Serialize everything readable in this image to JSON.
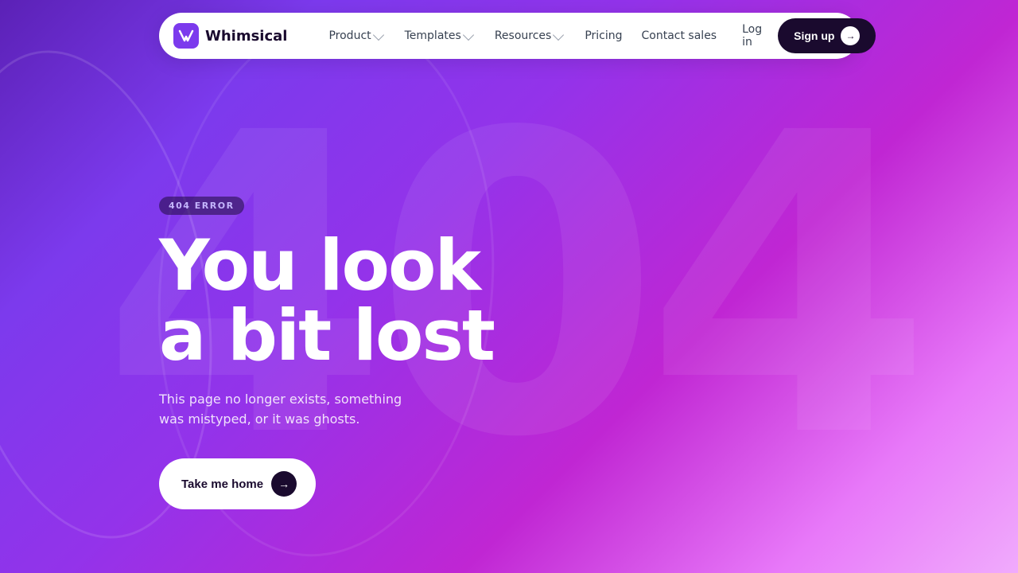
{
  "background": {
    "bg404text": "404"
  },
  "navbar": {
    "logo_text": "Whimsical",
    "links": [
      {
        "label": "Product",
        "has_chevron": true
      },
      {
        "label": "Templates",
        "has_chevron": true
      },
      {
        "label": "Resources",
        "has_chevron": true
      },
      {
        "label": "Pricing",
        "has_chevron": false
      }
    ],
    "contact_label": "Contact sales",
    "login_label": "Log in",
    "signup_label": "Sign up"
  },
  "hero": {
    "badge_text": "404 ERROR",
    "headline_line1": "You look",
    "headline_line2": "a bit lost",
    "subtext": "This page no longer exists, something was mistyped, or it was ghosts.",
    "cta_label": "Take me home"
  }
}
